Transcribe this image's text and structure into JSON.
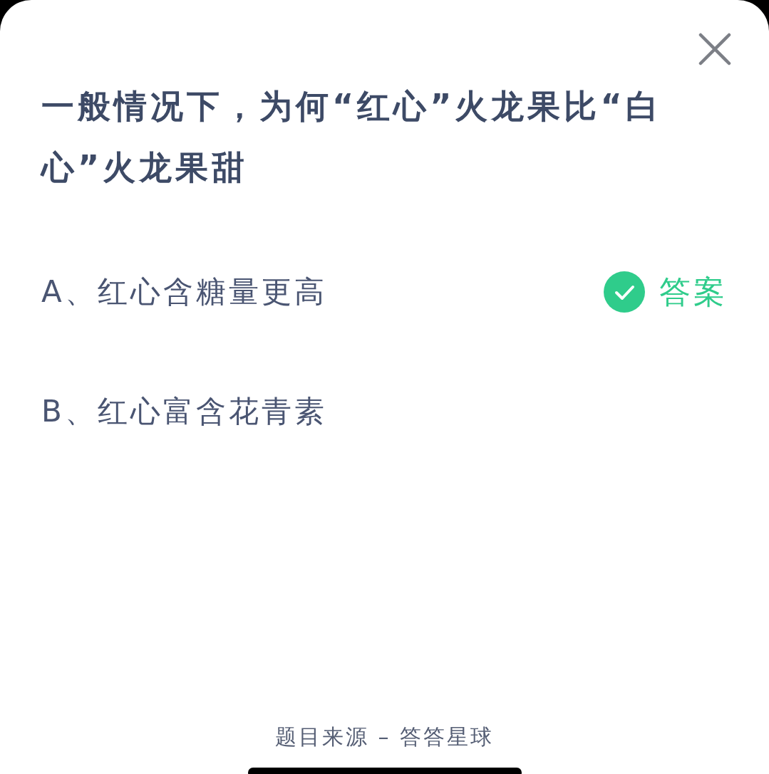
{
  "question": {
    "title": "一般情况下，为何“红心”火龙果比“白心”火龙果甜"
  },
  "options": [
    {
      "label": "A、红心含糖量更高",
      "correct": true
    },
    {
      "label": "B、红心富含花青素",
      "correct": false
    }
  ],
  "answer_label": "答案",
  "footer": "题目来源 – 答答星球"
}
